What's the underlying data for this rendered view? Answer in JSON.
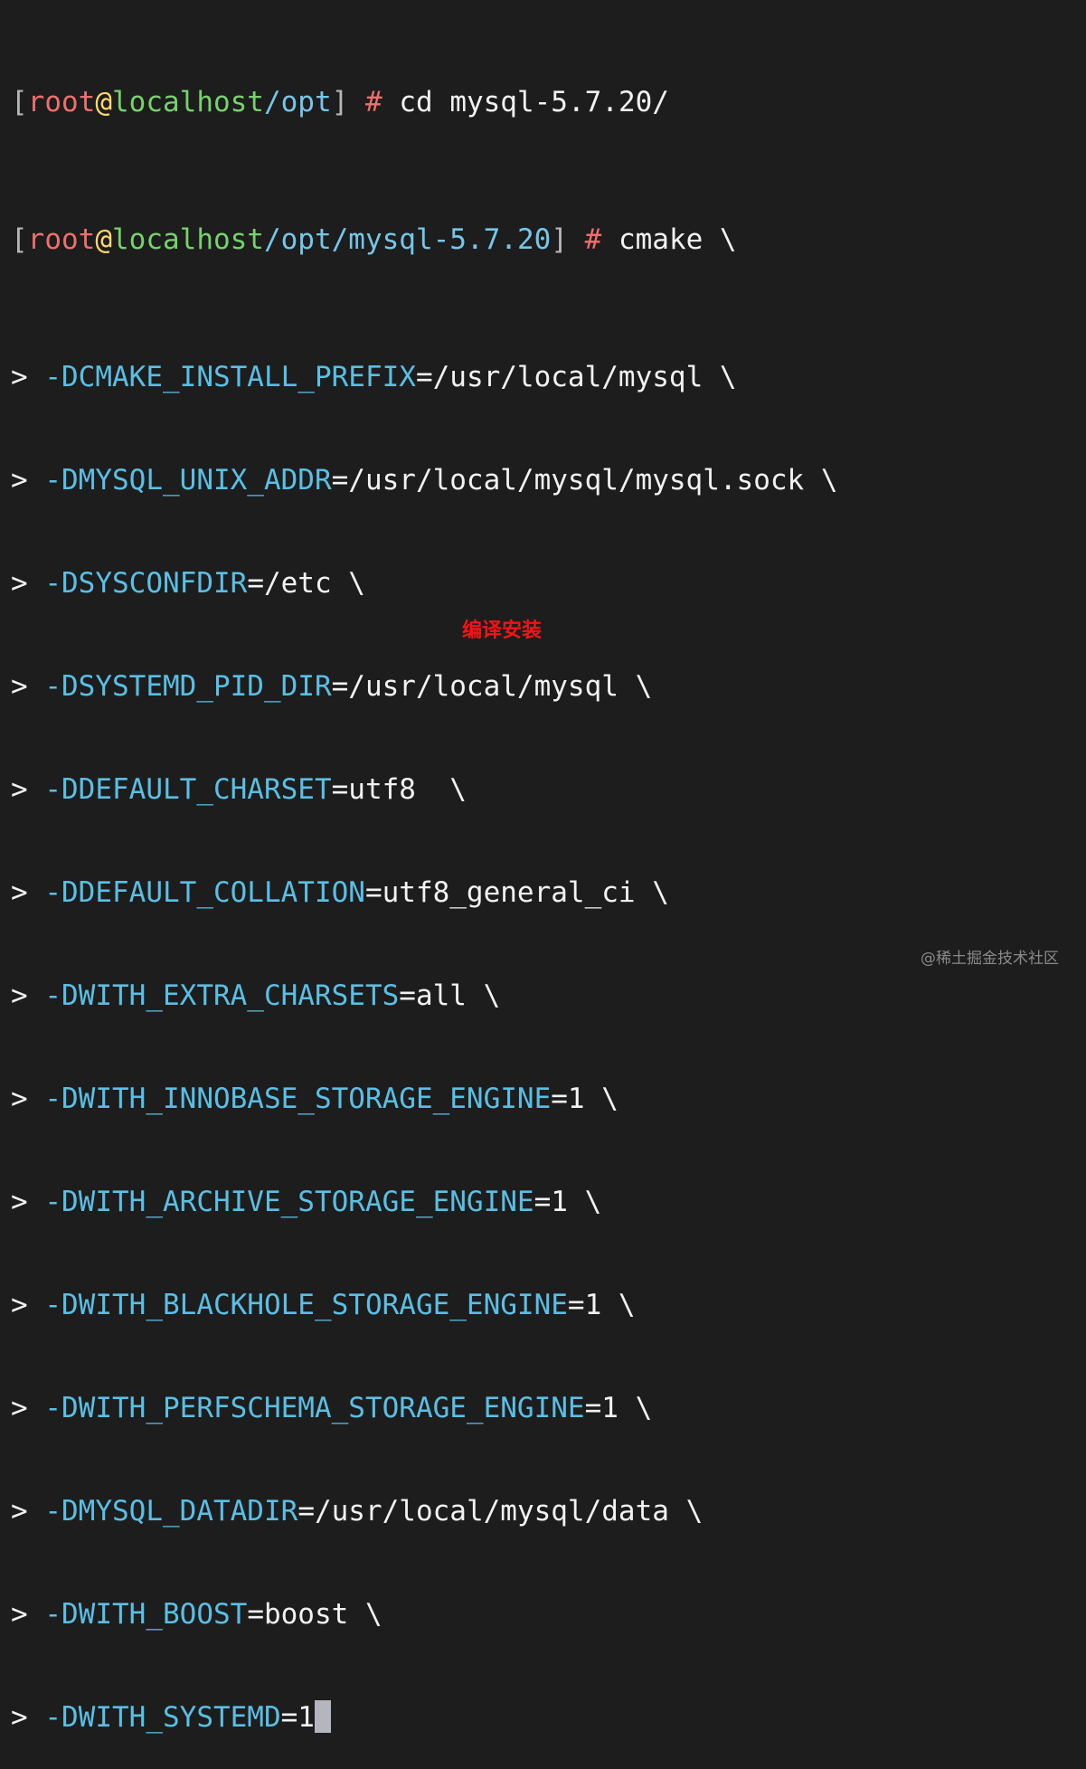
{
  "terminal": {
    "prompt1": {
      "open": "[",
      "user": "root",
      "at": "@",
      "host": "localhost",
      "path": "/opt",
      "close": "]",
      "hash": "#",
      "command": "cd mysql-5.7.20/"
    },
    "prompt2": {
      "open": "[",
      "user": "root",
      "at": "@",
      "host": "localhost",
      "path": "/opt/mysql-5.7.20",
      "close": "]",
      "hash": "#",
      "command": "cmake \\"
    },
    "continuation_marker": ">",
    "options": [
      {
        "flag": "-DCMAKE_INSTALL_PREFIX",
        "value": "=/usr/local/mysql \\"
      },
      {
        "flag": "-DMYSQL_UNIX_ADDR",
        "value": "=/usr/local/mysql/mysql.sock \\"
      },
      {
        "flag": "-DSYSCONFDIR",
        "value": "=/etc \\"
      },
      {
        "flag": "-DSYSTEMD_PID_DIR",
        "value": "=/usr/local/mysql \\"
      },
      {
        "flag": "-DDEFAULT_CHARSET",
        "value": "=utf8  \\"
      },
      {
        "flag": "-DDEFAULT_COLLATION",
        "value": "=utf8_general_ci \\"
      },
      {
        "flag": "-DWITH_EXTRA_CHARSETS",
        "value": "=all \\"
      },
      {
        "flag": "-DWITH_INNOBASE_STORAGE_ENGINE",
        "value": "=1 \\"
      },
      {
        "flag": "-DWITH_ARCHIVE_STORAGE_ENGINE",
        "value": "=1 \\"
      },
      {
        "flag": "-DWITH_BLACKHOLE_STORAGE_ENGINE",
        "value": "=1 \\"
      },
      {
        "flag": "-DWITH_PERFSCHEMA_STORAGE_ENGINE",
        "value": "=1 \\"
      },
      {
        "flag": "-DMYSQL_DATADIR",
        "value": "=/usr/local/mysql/data \\"
      },
      {
        "flag": "-DWITH_BOOST",
        "value": "=boost \\"
      },
      {
        "flag": "-DWITH_SYSTEMD",
        "value": "=1"
      }
    ]
  },
  "caption": "编译安装",
  "watermark": "@稀土掘金技术社区",
  "colors": {
    "background": "#1d1d1d",
    "user": "#f06f6c",
    "at": "#ffd86b",
    "host": "#76d26b",
    "path": "#75c7ea",
    "option_flag": "#59bfe5",
    "caption": "#f11515",
    "cursor": "#b5b5bd"
  }
}
